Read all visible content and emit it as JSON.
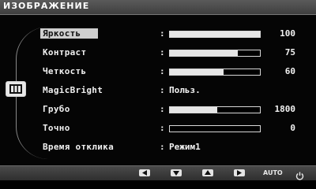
{
  "osd": {
    "title": "ИЗОБРАЖЕНИЕ",
    "category_icon": "picture-icon",
    "separator": ":",
    "items": [
      {
        "label": "Яркость",
        "type": "slider",
        "level": 100,
        "value": "100",
        "selected": true
      },
      {
        "label": "Контраст",
        "type": "slider",
        "level": 75,
        "value": "75"
      },
      {
        "label": "Четкость",
        "type": "slider",
        "level": 60,
        "value": "60"
      },
      {
        "label": "MagicBright",
        "type": "text",
        "value": "Польз."
      },
      {
        "label": "Грубо",
        "type": "slider",
        "level": 53,
        "value": "1800"
      },
      {
        "label": "Точно",
        "type": "slider",
        "level": 0,
        "value": "0"
      },
      {
        "label": "Время отклика",
        "type": "text",
        "value": "Режим1"
      }
    ],
    "buttons": {
      "left_icon": "triangle-left-icon",
      "down_icon": "triangle-down-icon",
      "up_icon": "triangle-up-icon",
      "right_icon": "triangle-right-icon",
      "auto_label": "AUTO",
      "power_icon": "power-icon"
    }
  }
}
